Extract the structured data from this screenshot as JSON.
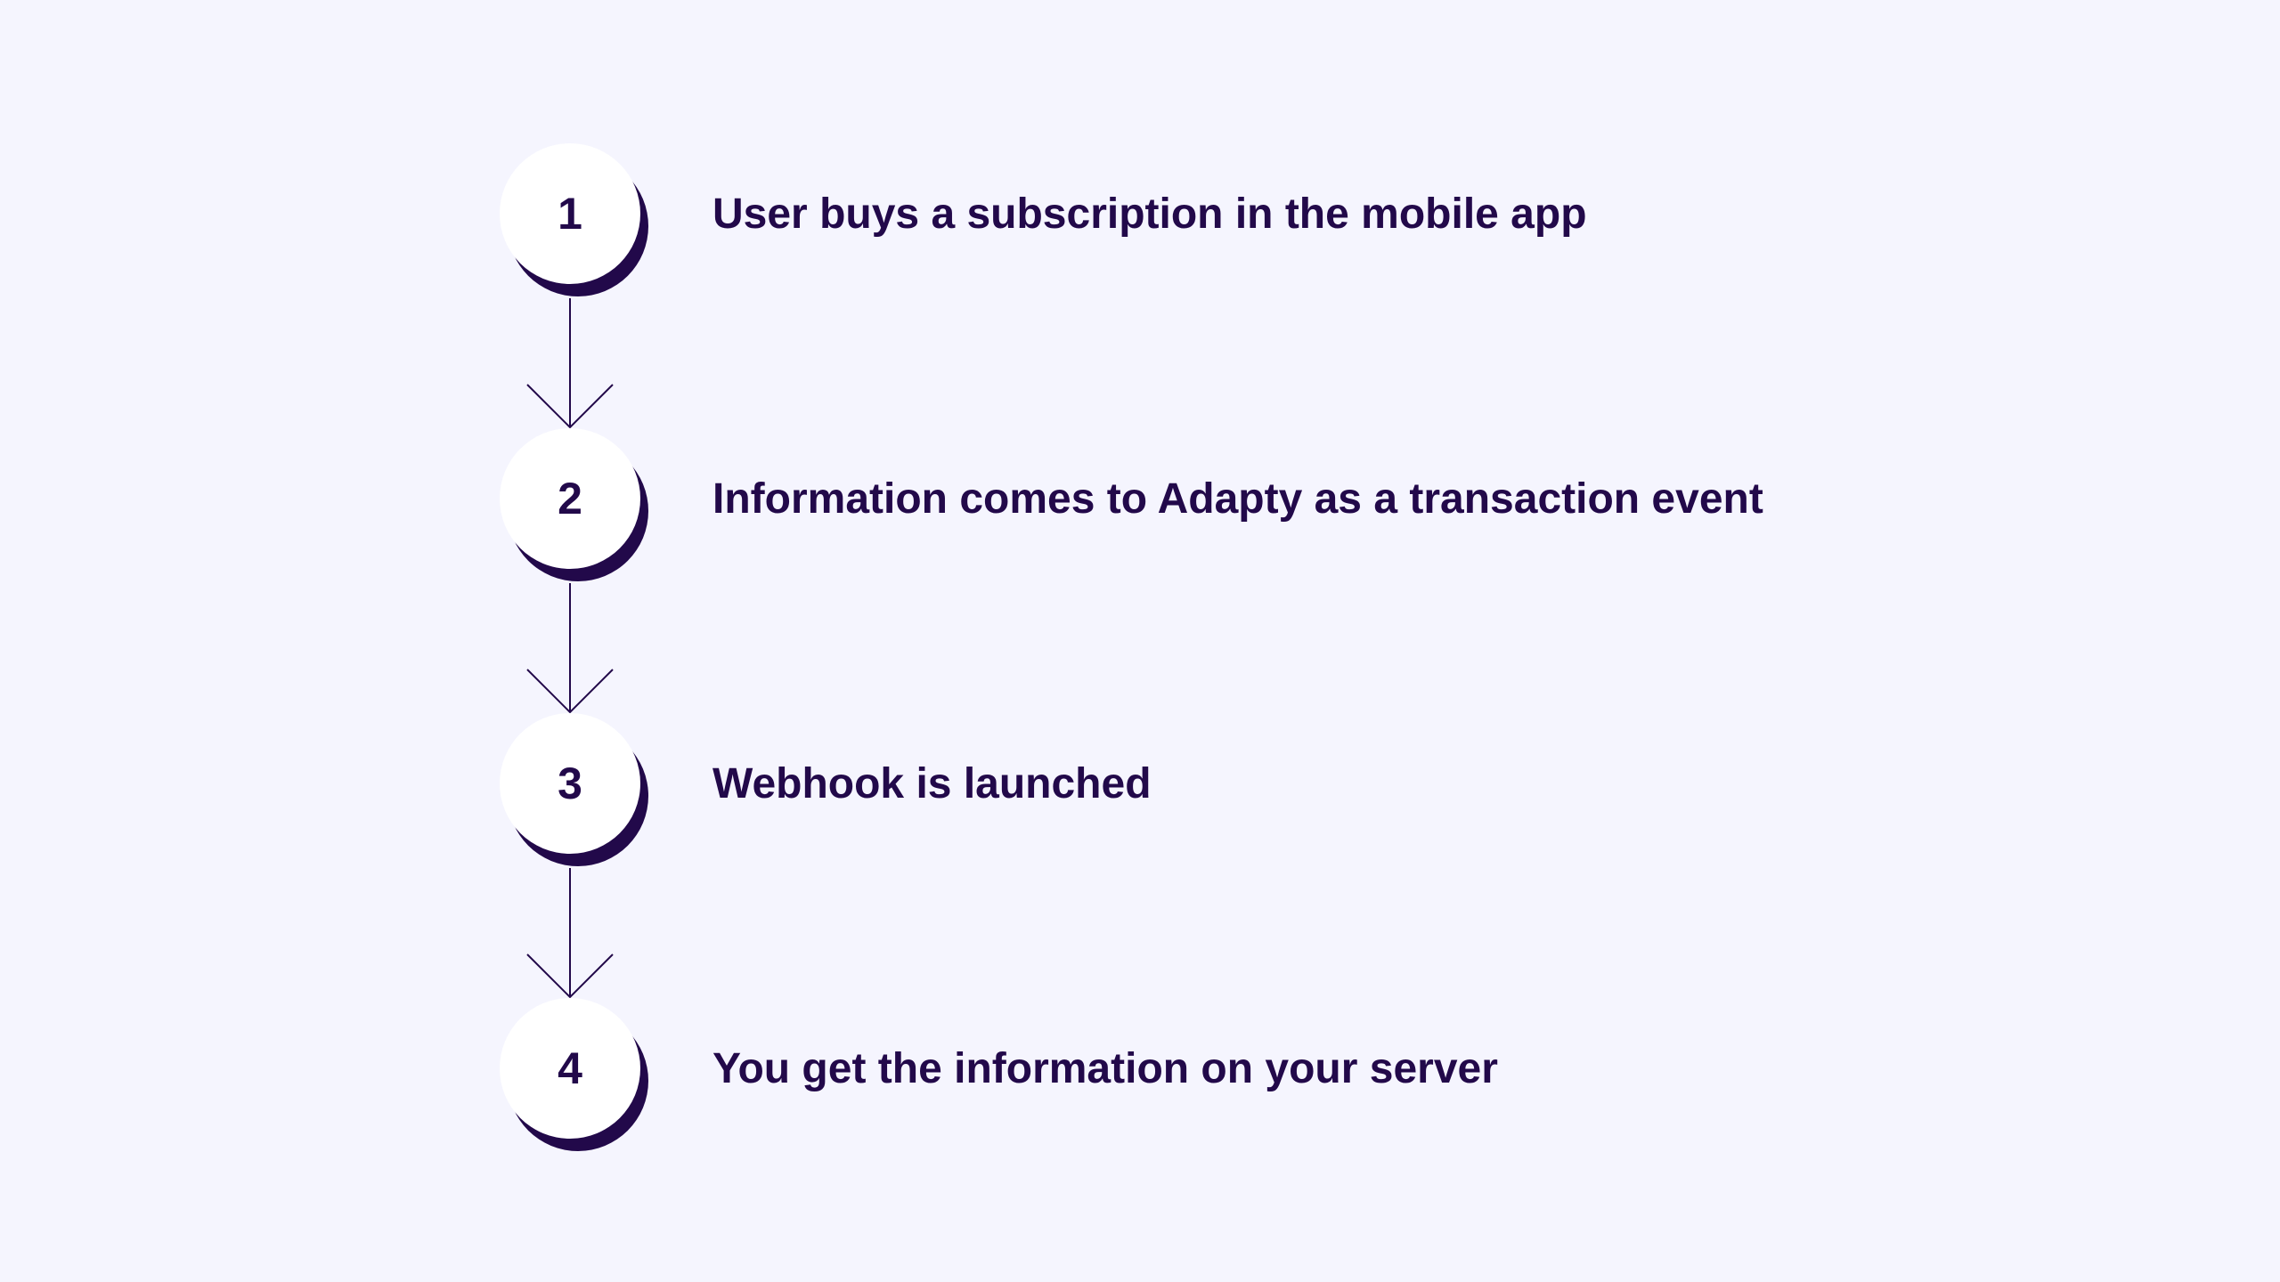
{
  "colors": {
    "background": "#f5f5fe",
    "accent": "#22094a",
    "circle_fill": "#ffffff"
  },
  "steps": [
    {
      "number": "1",
      "label": "User buys a subscription in the mobile app"
    },
    {
      "number": "2",
      "label": "Information comes to Adapty as a transaction event"
    },
    {
      "number": "3",
      "label": "Webhook is launched"
    },
    {
      "number": "4",
      "label": "You get the information on your server"
    }
  ]
}
